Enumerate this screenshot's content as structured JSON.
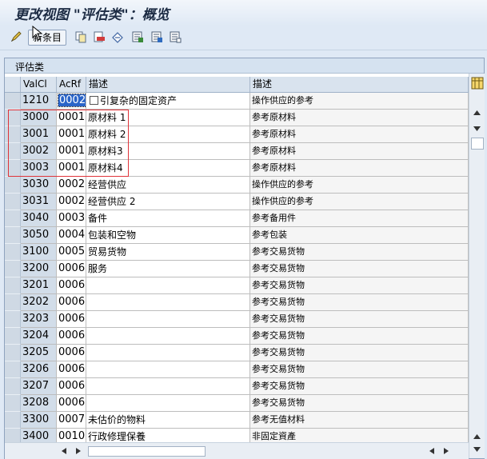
{
  "window": {
    "title": "更改视图 \"评估类\"：概览"
  },
  "toolbar": {
    "entries_button_label": "新条目",
    "icons": [
      "edit-pencil-icon",
      "new-entries-button",
      "copy-icon",
      "delete-icon",
      "undo-icon",
      "select-all-icon",
      "select-block-icon",
      "deselect-all-icon"
    ]
  },
  "panel": {
    "title": "评估类"
  },
  "table": {
    "columns": [
      "ValCl",
      "AcRf",
      "描述",
      "描述"
    ],
    "rows": [
      {
        "valcl": "1210",
        "acrf": "0002",
        "desc1": "引复杂的固定资产",
        "desc2": "操作供应的参考",
        "selected": true,
        "checkbox": true
      },
      {
        "valcl": "3000",
        "acrf": "0001",
        "desc1": "原材料 1",
        "desc2": "参考原材料"
      },
      {
        "valcl": "3001",
        "acrf": "0001",
        "desc1": "原材料 2",
        "desc2": "参考原材料"
      },
      {
        "valcl": "3002",
        "acrf": "0001",
        "desc1": "原材料3",
        "desc2": "参考原材料"
      },
      {
        "valcl": "3003",
        "acrf": "0001",
        "desc1": "原材料4",
        "desc2": "参考原材料"
      },
      {
        "valcl": "3030",
        "acrf": "0002",
        "desc1": "经营供应",
        "desc2": "操作供应的参考"
      },
      {
        "valcl": "3031",
        "acrf": "0002",
        "desc1": "经营供应 2",
        "desc2": "操作供应的参考"
      },
      {
        "valcl": "3040",
        "acrf": "0003",
        "desc1": "备件",
        "desc2": "参考备用件"
      },
      {
        "valcl": "3050",
        "acrf": "0004",
        "desc1": "包装和空物",
        "desc2": "参考包装"
      },
      {
        "valcl": "3100",
        "acrf": "0005",
        "desc1": "贸易货物",
        "desc2": "参考交易货物"
      },
      {
        "valcl": "3200",
        "acrf": "0006",
        "desc1": "服务",
        "desc2": "参考交易货物"
      },
      {
        "valcl": "3201",
        "acrf": "0006",
        "desc1": "",
        "desc2": "参考交易货物"
      },
      {
        "valcl": "3202",
        "acrf": "0006",
        "desc1": "",
        "desc2": "参考交易货物"
      },
      {
        "valcl": "3203",
        "acrf": "0006",
        "desc1": "",
        "desc2": "参考交易货物"
      },
      {
        "valcl": "3204",
        "acrf": "0006",
        "desc1": "",
        "desc2": "参考交易货物"
      },
      {
        "valcl": "3205",
        "acrf": "0006",
        "desc1": "",
        "desc2": "参考交易货物"
      },
      {
        "valcl": "3206",
        "acrf": "0006",
        "desc1": "",
        "desc2": "参考交易货物"
      },
      {
        "valcl": "3207",
        "acrf": "0006",
        "desc1": "",
        "desc2": "参考交易货物"
      },
      {
        "valcl": "3208",
        "acrf": "0006",
        "desc1": "",
        "desc2": "参考交易货物"
      },
      {
        "valcl": "3300",
        "acrf": "0007",
        "desc1": "未估价的物料",
        "desc2": "参考无值材料"
      },
      {
        "valcl": "3400",
        "acrf": "0010",
        "desc1": "行政修理保養",
        "desc2": "非固定資產"
      }
    ]
  },
  "colors": {
    "highlight": "#2a64c8",
    "annotation_box": "#e0343a"
  }
}
